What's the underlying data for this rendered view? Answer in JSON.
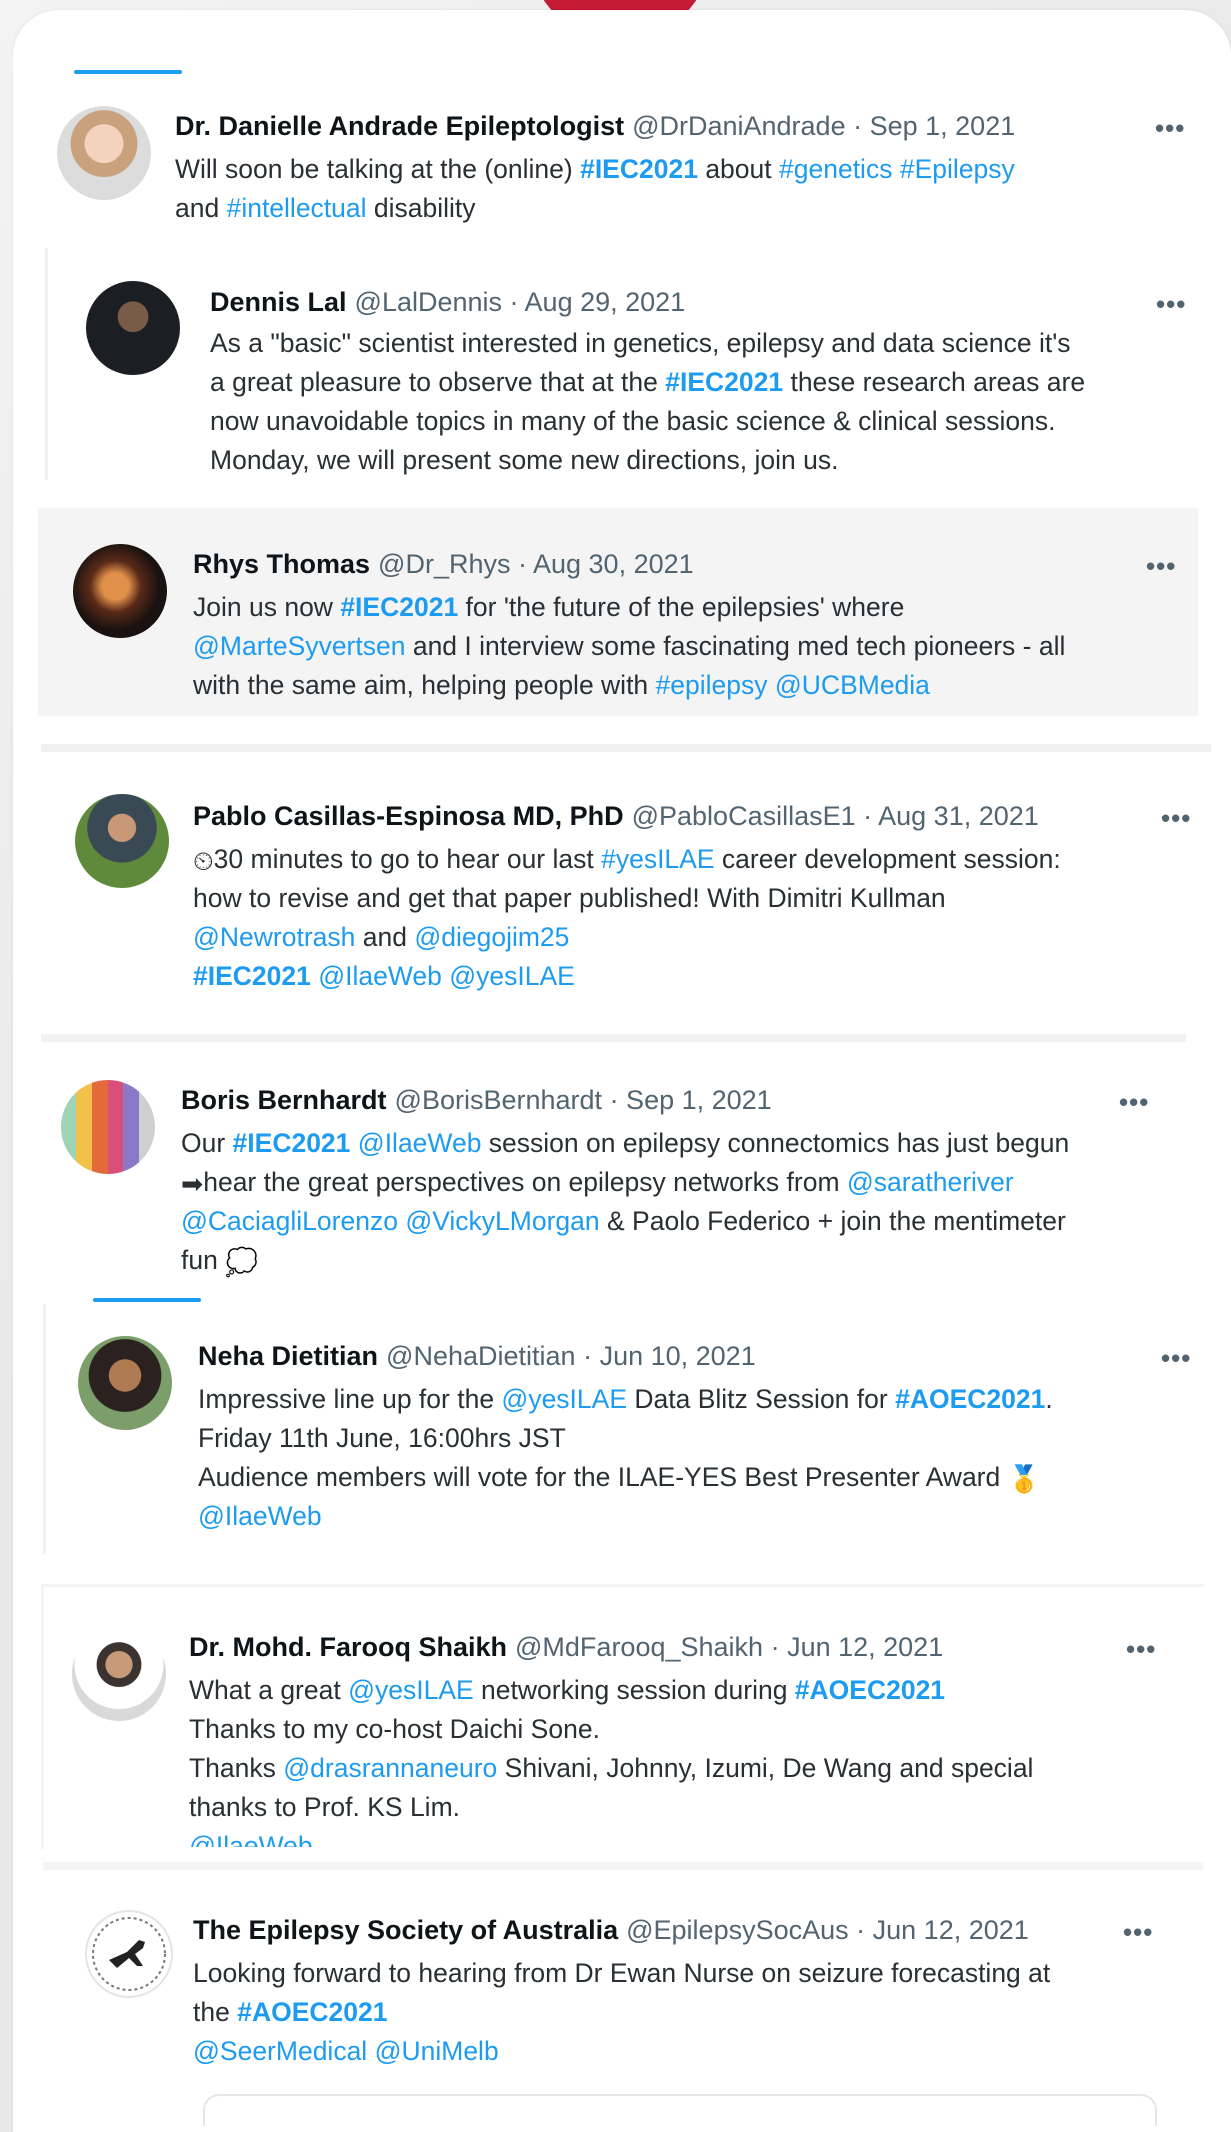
{
  "tweets": [
    {
      "name": "Dr. Danielle Andrade Epileptologist",
      "handle": "@DrDaniAndrade",
      "date": "· Sep 1, 2021",
      "lines": [
        [
          {
            "t": "Will soon be talking at the (online) "
          },
          {
            "t": "#IEC2021",
            "k": "tag"
          },
          {
            "t": " about "
          },
          {
            "t": "#genetics",
            "k": "link"
          },
          {
            "t": " "
          },
          {
            "t": "#Epilepsy",
            "k": "link"
          }
        ],
        [
          {
            "t": "and "
          },
          {
            "t": "#intellectual",
            "k": "link"
          },
          {
            "t": " disability"
          }
        ]
      ]
    },
    {
      "name": "Dennis Lal",
      "handle": "@LalDennis",
      "date": "· Aug 29, 2021",
      "lines": [
        [
          {
            "t": "As a \"basic\" scientist interested in genetics, epilepsy and data science it's"
          }
        ],
        [
          {
            "t": "a great pleasure to observe that at the "
          },
          {
            "t": "#IEC2021",
            "k": "tag"
          },
          {
            "t": " these research areas are"
          }
        ],
        [
          {
            "t": "now unavoidable topics in many of the basic science & clinical sessions."
          }
        ],
        [
          {
            "t": "Monday, we will present some new directions, join us."
          }
        ]
      ]
    },
    {
      "name": "Rhys Thomas",
      "handle": "@Dr_Rhys",
      "date": "· Aug 30, 2021",
      "lines": [
        [
          {
            "t": "Join us now "
          },
          {
            "t": "#IEC2021",
            "k": "tag"
          },
          {
            "t": " for 'the future of the epilepsies' where"
          }
        ],
        [
          {
            "t": "@MarteSyvertsen",
            "k": "link"
          },
          {
            "t": " and I interview some fascinating med tech pioneers - all"
          }
        ],
        [
          {
            "t": "with the same aim, helping people with "
          },
          {
            "t": "#epilepsy",
            "k": "link"
          },
          {
            "t": " "
          },
          {
            "t": "@UCBMedia",
            "k": "link"
          }
        ]
      ]
    },
    {
      "name": "Pablo Casillas-Espinosa MD, PhD",
      "handle": "@PabloCasillasE1",
      "date": "· Aug 31, 2021",
      "lines": [
        [
          {
            "t": "⏲ ",
            "k": "emoji"
          },
          {
            "t": "30 minutes to go to hear our last "
          },
          {
            "t": "#yesILAE",
            "k": "link"
          },
          {
            "t": " career development session:"
          }
        ],
        [
          {
            "t": "how to revise and get that paper published! With Dimitri Kullman"
          }
        ],
        [
          {
            "t": "@Newrotrash",
            "k": "link"
          },
          {
            "t": " and "
          },
          {
            "t": "@diegojim25",
            "k": "link"
          }
        ],
        [
          {
            "t": "#IEC2021",
            "k": "tag"
          },
          {
            "t": " "
          },
          {
            "t": "@IlaeWeb",
            "k": "link"
          },
          {
            "t": " "
          },
          {
            "t": "@yesILAE",
            "k": "link"
          }
        ]
      ]
    },
    {
      "name": "Boris Bernhardt",
      "handle": "@BorisBernhardt",
      "date": "· Sep 1, 2021",
      "lines": [
        [
          {
            "t": "Our "
          },
          {
            "t": "#IEC2021",
            "k": "tag"
          },
          {
            "t": " "
          },
          {
            "t": "@IlaeWeb",
            "k": "link"
          },
          {
            "t": " session on epilepsy connectomics has just begun"
          }
        ],
        [
          {
            "t": "➡",
            "k": "emoji"
          },
          {
            "t": "hear the great perspectives on epilepsy networks from "
          },
          {
            "t": "@saratheriver",
            "k": "link"
          }
        ],
        [
          {
            "t": "@CaciagliLorenzo",
            "k": "link"
          },
          {
            "t": " "
          },
          {
            "t": "@VickyLMorgan",
            "k": "link"
          },
          {
            "t": " & Paolo Federico + join the mentimeter"
          }
        ],
        [
          {
            "t": "fun "
          },
          {
            "t": "💭",
            "k": "emoji"
          }
        ]
      ]
    },
    {
      "name": "Neha Dietitian",
      "handle": "@NehaDietitian",
      "date": "· Jun 10, 2021",
      "lines": [
        [
          {
            "t": "Impressive line up for the "
          },
          {
            "t": "@yesILAE",
            "k": "link"
          },
          {
            "t": " Data Blitz Session for "
          },
          {
            "t": "#AOEC2021",
            "k": "tag"
          },
          {
            "t": "."
          }
        ],
        [
          {
            "t": "Friday 11th June, 16:00hrs JST"
          }
        ],
        [
          {
            "t": "Audience members will vote for the ILAE-YES Best Presenter Award "
          },
          {
            "t": "🥇",
            "k": "emoji"
          }
        ],
        [
          {
            "t": "@IlaeWeb",
            "k": "link"
          }
        ]
      ]
    },
    {
      "name": "Dr. Mohd. Farooq Shaikh",
      "handle": "@MdFarooq_Shaikh",
      "date": "· Jun 12, 2021",
      "lines": [
        [
          {
            "t": "What a great "
          },
          {
            "t": "@yesILAE",
            "k": "link"
          },
          {
            "t": " networking session during "
          },
          {
            "t": "#AOEC2021",
            "k": "tag"
          }
        ],
        [
          {
            "t": "Thanks to my co-host Daichi Sone."
          }
        ],
        [
          {
            "t": "Thanks "
          },
          {
            "t": "@drasrannaneuro",
            "k": "link"
          },
          {
            "t": " Shivani, Johnny, Izumi, De Wang and special"
          }
        ],
        [
          {
            "t": "thanks to Prof. KS Lim."
          }
        ],
        [
          {
            "t": "@IlaeWeb",
            "k": "link"
          }
        ]
      ]
    },
    {
      "name": "The Epilepsy Society of Australia",
      "handle": "@EpilepsySocAus",
      "date": "· Jun 12, 2021",
      "lines": [
        [
          {
            "t": "Looking forward to hearing from Dr Ewan Nurse on seizure forecasting at"
          }
        ],
        [
          {
            "t": "the "
          },
          {
            "t": "#AOEC2021",
            "k": "tag"
          }
        ],
        [
          {
            "t": "@SeerMedical",
            "k": "link"
          },
          {
            "t": " "
          },
          {
            "t": "@UniMelb",
            "k": "link"
          }
        ]
      ]
    }
  ],
  "more_label": "•••",
  "colors": {
    "accent": "#1d9bf0",
    "brand_red": "#c41a33",
    "name": "#0f1419",
    "meta": "#536471"
  }
}
